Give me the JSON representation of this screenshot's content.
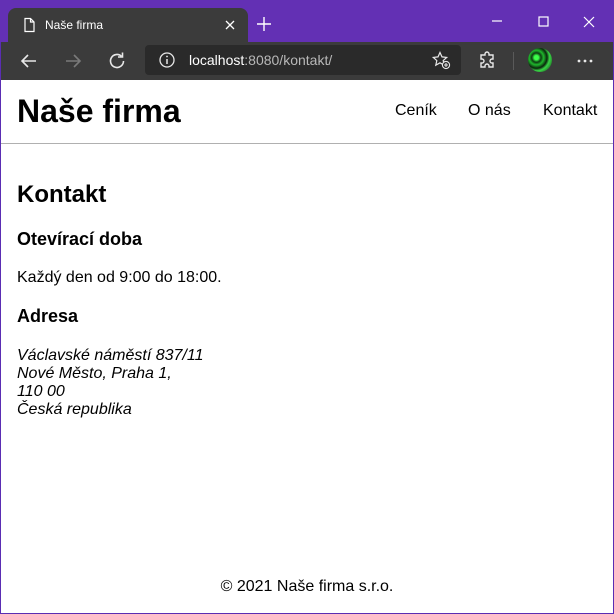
{
  "browser": {
    "tab_title": "Naše firma",
    "url_host": "localhost",
    "url_rest": ":8080/kontakt/"
  },
  "site": {
    "title": "Naše firma",
    "nav": [
      "Ceník",
      "O nás",
      "Kontakt"
    ]
  },
  "content": {
    "heading": "Kontakt",
    "hours_heading": "Otevírací doba",
    "hours_text": "Každý den od 9:00 do 18:00.",
    "address_heading": "Adresa",
    "address_lines": [
      "Václavské náměstí 837/11",
      "Nové Město, Praha 1,",
      "110 00",
      "Česká republika"
    ]
  },
  "footer": {
    "text": "© 2021 Naše firma s.r.o."
  },
  "colors": {
    "frame": "#6330b4",
    "toolbar": "#3b3b3b",
    "page_bg": "#ffffff"
  }
}
